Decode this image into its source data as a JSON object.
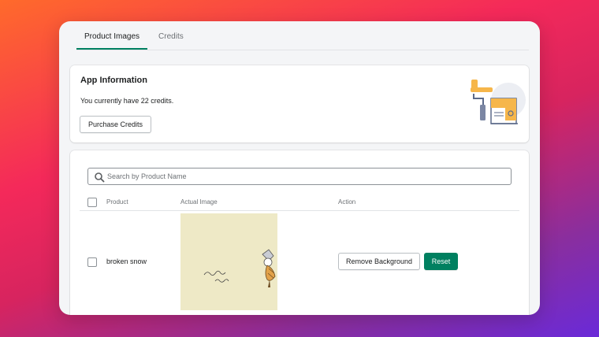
{
  "tabs": [
    {
      "label": "Product Images",
      "active": true
    },
    {
      "label": "Credits",
      "active": false
    }
  ],
  "app_info": {
    "title": "App Information",
    "credits_text": "You currently have 22 credits.",
    "purchase_label": "Purchase Credits"
  },
  "search": {
    "placeholder": "Search by Product Name",
    "value": ""
  },
  "table": {
    "headers": [
      "Product",
      "Actual Image",
      "Action"
    ],
    "rows": [
      {
        "product": "broken snow",
        "remove_label": "Remove Background",
        "reset_label": "Reset"
      }
    ]
  },
  "colors": {
    "accent": "#008060",
    "thumb_bg": "#eee9c6"
  }
}
